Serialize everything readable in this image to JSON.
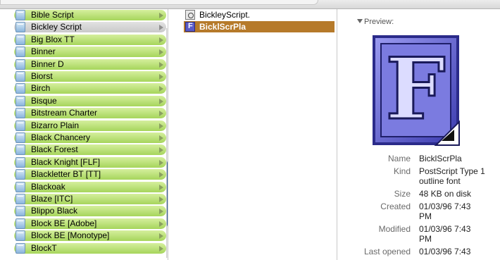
{
  "fonts_column": {
    "items": [
      {
        "label": "Bible Script"
      },
      {
        "label": "Bickley Script",
        "selected": true
      },
      {
        "label": "Big Blox TT"
      },
      {
        "label": "Binner"
      },
      {
        "label": "Binner D"
      },
      {
        "label": "Biorst"
      },
      {
        "label": "Birch"
      },
      {
        "label": "Bisque"
      },
      {
        "label": "Bitstream Charter"
      },
      {
        "label": "Bizarro Plain"
      },
      {
        "label": "Black Chancery"
      },
      {
        "label": "Black Forest"
      },
      {
        "label": "Black Knight [FLF]"
      },
      {
        "label": "Blackletter BT [TT]"
      },
      {
        "label": "Blackoak"
      },
      {
        "label": "Blaze [ITC]"
      },
      {
        "label": "Blippo Black"
      },
      {
        "label": "Block BE [Adobe]"
      },
      {
        "label": "Block BE [Monotype]"
      },
      {
        "label": "BlockT"
      }
    ]
  },
  "files_column": {
    "items": [
      {
        "label": "BickleyScript.",
        "icon": "script-file-icon"
      },
      {
        "label": "BicklScrPla",
        "icon": "font-file-icon",
        "selected": true
      }
    ]
  },
  "preview": {
    "header": "Preview:",
    "icon_letter": "F",
    "info": [
      {
        "key": "Name",
        "lines": [
          "BicklScrPla"
        ]
      },
      {
        "key": "Kind",
        "lines": [
          "PostScript Type 1",
          "outline font"
        ]
      },
      {
        "key": "Size",
        "lines": [
          "48 KB on disk"
        ]
      },
      {
        "key": "Created",
        "lines": [
          "01/03/96 7:43",
          "PM"
        ]
      },
      {
        "key": "Modified",
        "lines": [
          "01/03/96 7:43",
          "PM"
        ]
      },
      {
        "key": "Last opened",
        "lines": [
          "01/03/96 7:43"
        ]
      }
    ]
  },
  "colors": {
    "row_green": "#a6d55c",
    "selection_orange": "#b67a2a",
    "scroll_blue": "#4f7fbf",
    "icon_purple": "#5a5ac8"
  }
}
